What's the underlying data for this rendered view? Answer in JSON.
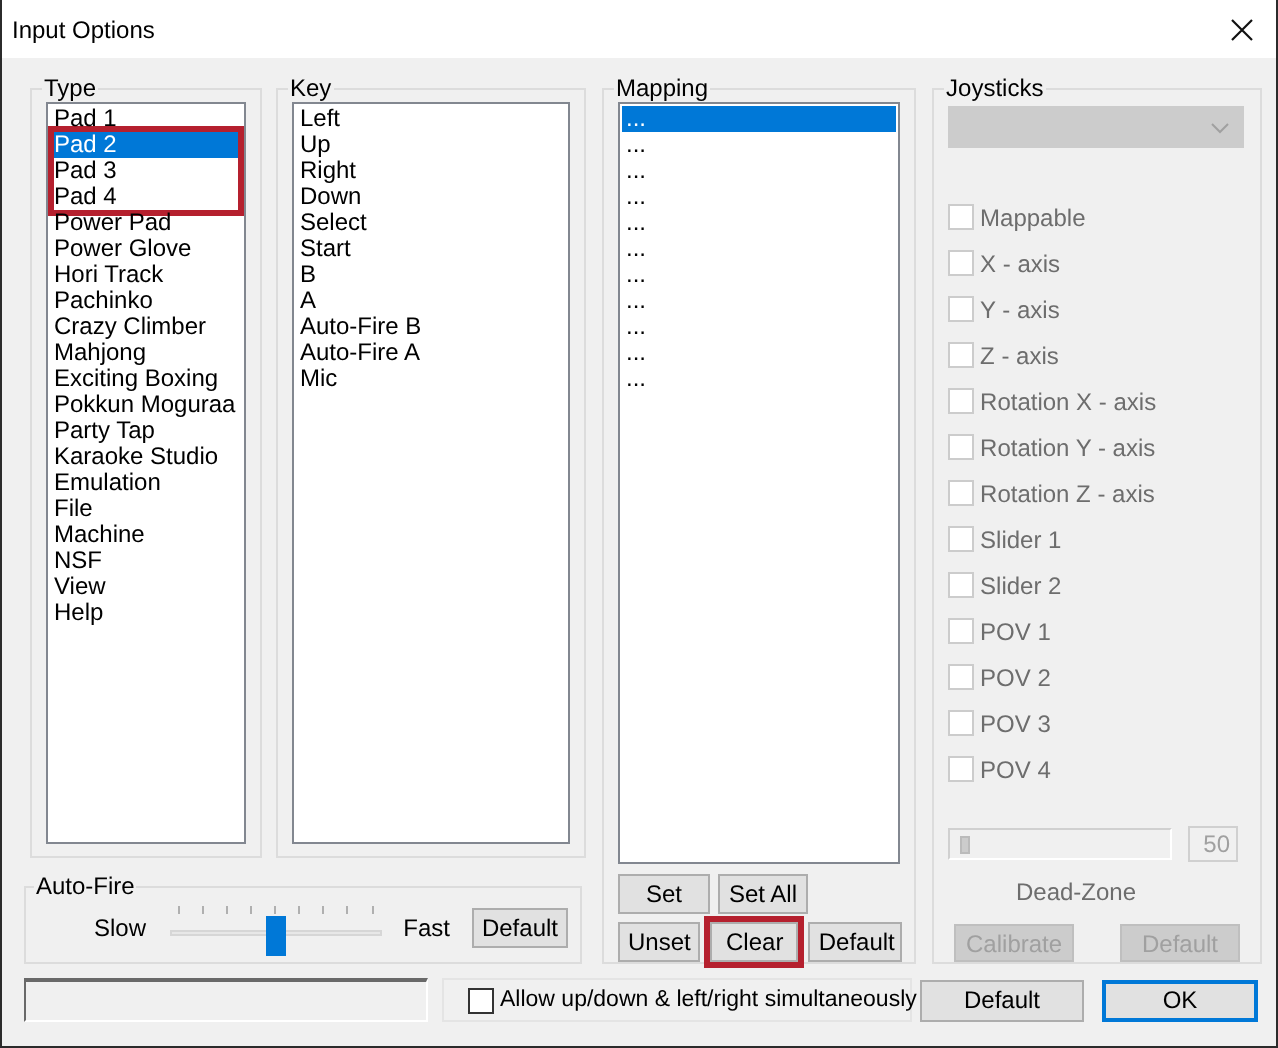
{
  "window": {
    "title": "Input Options"
  },
  "type_group": {
    "label": "Type",
    "items": [
      {
        "label": "Pad 1",
        "selected": false,
        "highlighted": false
      },
      {
        "label": "Pad 2",
        "selected": true,
        "highlighted": true
      },
      {
        "label": "Pad 3",
        "selected": false,
        "highlighted": true
      },
      {
        "label": "Pad 4",
        "selected": false,
        "highlighted": true
      },
      {
        "label": "Power Pad",
        "selected": false,
        "highlighted": false
      },
      {
        "label": "Power Glove",
        "selected": false,
        "highlighted": false
      },
      {
        "label": "Hori Track",
        "selected": false,
        "highlighted": false
      },
      {
        "label": "Pachinko",
        "selected": false,
        "highlighted": false
      },
      {
        "label": "Crazy Climber",
        "selected": false,
        "highlighted": false
      },
      {
        "label": "Mahjong",
        "selected": false,
        "highlighted": false
      },
      {
        "label": "Exciting Boxing",
        "selected": false,
        "highlighted": false
      },
      {
        "label": "Pokkun Moguraa",
        "selected": false,
        "highlighted": false
      },
      {
        "label": "Party Tap",
        "selected": false,
        "highlighted": false
      },
      {
        "label": "Karaoke Studio",
        "selected": false,
        "highlighted": false
      },
      {
        "label": "Emulation",
        "selected": false,
        "highlighted": false
      },
      {
        "label": "File",
        "selected": false,
        "highlighted": false
      },
      {
        "label": "Machine",
        "selected": false,
        "highlighted": false
      },
      {
        "label": "NSF",
        "selected": false,
        "highlighted": false
      },
      {
        "label": "View",
        "selected": false,
        "highlighted": false
      },
      {
        "label": "Help",
        "selected": false,
        "highlighted": false
      }
    ]
  },
  "key_group": {
    "label": "Key",
    "items": [
      "Left",
      "Up",
      "Right",
      "Down",
      "Select",
      "Start",
      "B",
      "A",
      "Auto-Fire B",
      "Auto-Fire A",
      "Mic"
    ]
  },
  "mapping_group": {
    "label": "Mapping",
    "items": [
      {
        "label": "...",
        "selected": true
      },
      {
        "label": "...",
        "selected": false
      },
      {
        "label": "...",
        "selected": false
      },
      {
        "label": "...",
        "selected": false
      },
      {
        "label": "...",
        "selected": false
      },
      {
        "label": "...",
        "selected": false
      },
      {
        "label": "...",
        "selected": false
      },
      {
        "label": "...",
        "selected": false
      },
      {
        "label": "...",
        "selected": false
      },
      {
        "label": "...",
        "selected": false
      },
      {
        "label": "...",
        "selected": false
      }
    ],
    "buttons_top": [
      {
        "label": "Set",
        "highlighted": false
      },
      {
        "label": "Set All",
        "highlighted": false
      }
    ],
    "buttons_bottom": [
      {
        "label": "Unset",
        "highlighted": false
      },
      {
        "label": "Clear",
        "highlighted": true
      },
      {
        "label": "Default",
        "highlighted": false
      }
    ]
  },
  "joysticks_group": {
    "label": "Joysticks",
    "dropdown": {
      "disabled": true
    },
    "options": [
      {
        "label": "Mappable",
        "checked": false,
        "disabled": true
      },
      {
        "label": "X - axis",
        "checked": false,
        "disabled": true
      },
      {
        "label": "Y - axis",
        "checked": false,
        "disabled": true
      },
      {
        "label": "Z - axis",
        "checked": false,
        "disabled": true
      },
      {
        "label": "Rotation X - axis",
        "checked": false,
        "disabled": true
      },
      {
        "label": "Rotation Y - axis",
        "checked": false,
        "disabled": true
      },
      {
        "label": "Rotation Z - axis",
        "checked": false,
        "disabled": true
      },
      {
        "label": "Slider 1",
        "checked": false,
        "disabled": true
      },
      {
        "label": "Slider 2",
        "checked": false,
        "disabled": true
      },
      {
        "label": "POV 1",
        "checked": false,
        "disabled": true
      },
      {
        "label": "POV 2",
        "checked": false,
        "disabled": true
      },
      {
        "label": "POV 3",
        "checked": false,
        "disabled": true
      },
      {
        "label": "POV 4",
        "checked": false,
        "disabled": true
      }
    ],
    "dead_zone": {
      "level": 0,
      "value": "50",
      "label": "Dead-Zone",
      "disabled": true
    },
    "buttons": [
      {
        "label": "Calibrate",
        "disabled": true
      },
      {
        "label": "Default",
        "disabled": true
      }
    ]
  },
  "auto_fire": {
    "label": "Auto-Fire",
    "slow_label": "Slow",
    "fast_label": "Fast",
    "level": 0.5,
    "button": "Default"
  },
  "simultaneous_option": {
    "label": "Allow up/down & left/right simultaneously",
    "checked": false
  },
  "dialog_buttons": [
    {
      "label": "Default",
      "default": false
    },
    {
      "label": "OK",
      "default": true
    }
  ]
}
